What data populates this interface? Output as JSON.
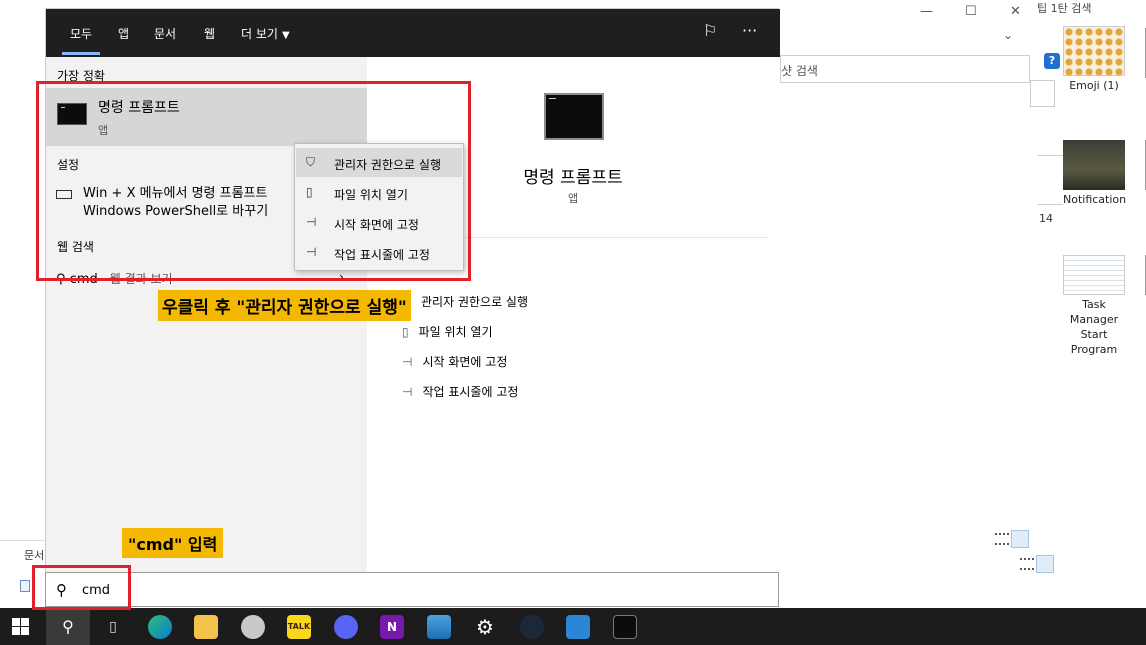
{
  "start_menu": {
    "tabs": [
      "모두",
      "앱",
      "문서",
      "웹",
      "더 보기"
    ],
    "top_icons": [
      "feedback-icon",
      "more-icon"
    ],
    "more_glyph": "···",
    "best_match": {
      "section_label": "가장 정확",
      "title": "명령 프롬프트",
      "subtitle": "앱"
    },
    "settings": {
      "section_label": "설정",
      "item_line1": "Win + X 메뉴에서 명령 프롬프트",
      "item_line2": "Windows PowerShell로 바꾸기"
    },
    "web_search": {
      "section_label": "웹 검색",
      "query": "cmd",
      "suffix": " - 웹 결과 보기",
      "go": "›"
    },
    "detail": {
      "title": "명령 프롬프트",
      "subtitle": "앱",
      "actions": [
        "관리자 권한으로 실행",
        "파일 위치 열기",
        "시작 화면에 고정",
        "작업 표시줄에 고정"
      ]
    }
  },
  "context_menu": {
    "items": [
      "관리자 권한으로 실행",
      "파일 위치 열기",
      "시작 화면에 고정",
      "작업 표시줄에 고정"
    ]
  },
  "search_box": {
    "value": "cmd"
  },
  "annotations": {
    "note_right_click": "우클릭 후 \"관리자 권한으로 실행\"",
    "note_input": "\"cmd\" 입력"
  },
  "background": {
    "explorer_search_placeholder": "샷 검색",
    "left_tab_label": "문서",
    "top_right_text": "팁 1탄 검색",
    "count_label": "14",
    "help_badge": "?",
    "thumbnails": [
      {
        "label": "Emoji (1)"
      },
      {
        "label": "Notification"
      },
      {
        "label": "Task Manager Start Program"
      }
    ]
  },
  "taskbar": {
    "icons": [
      "edge-icon",
      "file-explorer-icon",
      "paint-icon",
      "kakaotalk-icon",
      "discord-icon",
      "onenote-icon",
      "photos-icon",
      "settings-icon",
      "steam-icon",
      "contact-icon",
      "terminal-icon"
    ],
    "kakaotalk_label": "TALK",
    "onenote_label": "N"
  },
  "colors": {
    "accent_red": "#e0212b",
    "highlight_yellow": "#f5b800",
    "start_header": "#1f1f1f",
    "taskbar": "#1c1c1c"
  }
}
